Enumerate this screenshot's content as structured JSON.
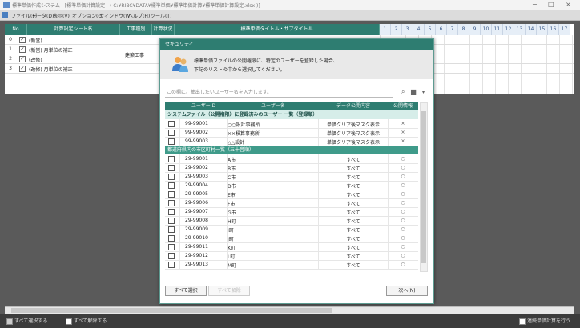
{
  "window": {
    "title": "標準単価作成システム - [標準単価計算設定 - ( C:¥RIBC¥DATA¥標準単価¥標準単価計算¥標準単価計算設定.xlsx )]",
    "min": "−",
    "max": "□",
    "close": "×"
  },
  "menu": [
    "ファイル(F)",
    "データ(D)",
    "表示(V)",
    "オプション(O)",
    "ウィンドウ(W)",
    "ヘルプ(H)",
    "ツール(T)"
  ],
  "sheet": {
    "headers": [
      "No",
      "計算設定シート名",
      "工事種別",
      "計算状況",
      "標準単価タイトル・サブタイトル"
    ],
    "column_numbers": [
      "1",
      "2",
      "3",
      "4",
      "5",
      "6",
      "7",
      "8",
      "9",
      "10",
      "11",
      "12",
      "13",
      "14",
      "15",
      "16",
      "17"
    ],
    "rows": [
      {
        "no": "0",
        "check": "✓",
        "name": "(新営)"
      },
      {
        "no": "1",
        "check": "✓",
        "name": "(新営) 月単位の補正"
      },
      {
        "no": "2",
        "check": "✓",
        "name": "(改修)"
      },
      {
        "no": "3",
        "check": "✓",
        "name": "(改修) 月単位の補正"
      }
    ],
    "kind": "建築工事"
  },
  "status": {
    "left": "すべて選択する",
    "unselect": "すべて解除する",
    "right": "連続単価計算を行う"
  },
  "dialog": {
    "title": "セキュリティ",
    "message_line1": "標準単価ファイルの公開権限に、特定のユーザーを登録した場合、",
    "message_line2": "下記のリストの中から選択してください。",
    "search_placeholder": "この欄に、抽出したいユーザー名を入力します。",
    "columns": [
      "ユーザーID",
      "ユーザー名",
      "データ公開内容",
      "公開情報"
    ],
    "group1": "システムファイル（公開権限）に登録済みのユーザー 一覧（登録順）",
    "group1_rows": [
      {
        "code": "99-99001",
        "name": "○○設計事務所",
        "pub": "単価クリア後マスク表示",
        "info": "×"
      },
      {
        "code": "99-99002",
        "name": "××積算事務所",
        "pub": "単価クリア後マスク表示",
        "info": "×"
      },
      {
        "code": "99-99003",
        "name": "△△設計",
        "pub": "単価クリア後マスク表示",
        "info": "×"
      }
    ],
    "group2": "都道府県内の市区町村一覧（五十音順）",
    "group2_rows": [
      {
        "code": "29-99001",
        "name": "A市",
        "pub": "すべて",
        "info": "○"
      },
      {
        "code": "29-99002",
        "name": "B市",
        "pub": "すべて",
        "info": "○"
      },
      {
        "code": "29-99003",
        "name": "C市",
        "pub": "すべて",
        "info": "○"
      },
      {
        "code": "29-99004",
        "name": "D市",
        "pub": "すべて",
        "info": "○"
      },
      {
        "code": "29-99005",
        "name": "E市",
        "pub": "すべて",
        "info": "○"
      },
      {
        "code": "29-99006",
        "name": "F市",
        "pub": "すべて",
        "info": "○"
      },
      {
        "code": "29-99007",
        "name": "G市",
        "pub": "すべて",
        "info": "○"
      },
      {
        "code": "29-99008",
        "name": "H町",
        "pub": "すべて",
        "info": "○"
      },
      {
        "code": "29-99009",
        "name": "I町",
        "pub": "すべて",
        "info": "○"
      },
      {
        "code": "29-99010",
        "name": "J町",
        "pub": "すべて",
        "info": "○"
      },
      {
        "code": "29-99011",
        "name": "K町",
        "pub": "すべて",
        "info": "○"
      },
      {
        "code": "29-99012",
        "name": "L町",
        "pub": "すべて",
        "info": "○"
      },
      {
        "code": "29-99013",
        "name": "M町",
        "pub": "すべて",
        "info": "○"
      }
    ],
    "select_all": "すべて選択",
    "clear_all": "すべて解除",
    "next": "次へ(N)",
    "search_icon": "search-icon",
    "folder_icon": "folder-icon"
  },
  "colors": {
    "accent": "#2e7d71",
    "group_band": "#3f9b8a"
  }
}
